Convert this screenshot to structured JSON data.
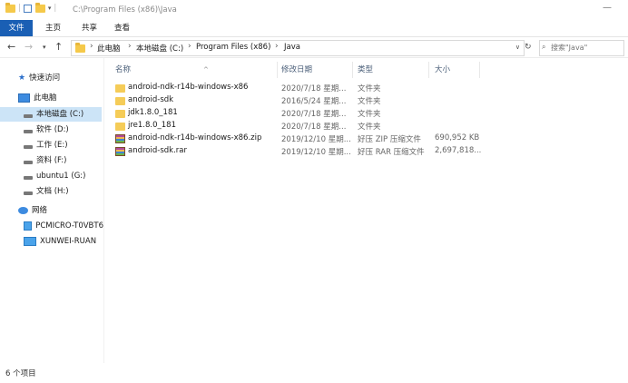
{
  "window": {
    "path": "C:\\Program Files (x86)\\Java"
  },
  "ribbon": {
    "tabs": [
      "文件",
      "主页",
      "共享",
      "查看"
    ]
  },
  "address": {
    "crumbs": [
      "此电脑",
      "本地磁盘 (C:)",
      "Program Files (x86)",
      "Java"
    ]
  },
  "search": {
    "placeholder": "搜索\"Java\""
  },
  "nav": {
    "quick_access": "快速访问",
    "this_pc": "此电脑",
    "drives": [
      "本地磁盘 (C:)",
      "软件 (D:)",
      "工作 (E:)",
      "资料 (F:)",
      "ubuntu1 (G:)",
      "文档 (H:)"
    ],
    "network": "网络",
    "computers": [
      "PCMICRO-T0VBT6",
      "XUNWEI-RUAN"
    ]
  },
  "columns": {
    "name": "名称",
    "date": "修改日期",
    "type": "类型",
    "size": "大小"
  },
  "files": [
    {
      "name": "android-ndk-r14b-windows-x86",
      "date": "2020/7/18 星期...",
      "type": "文件夹",
      "size": "",
      "icon": "folder-icon"
    },
    {
      "name": "android-sdk",
      "date": "2016/5/24 星期...",
      "type": "文件夹",
      "size": "",
      "icon": "folder-icon"
    },
    {
      "name": "jdk1.8.0_181",
      "date": "2020/7/18 星期...",
      "type": "文件夹",
      "size": "",
      "icon": "folder-icon"
    },
    {
      "name": "jre1.8.0_181",
      "date": "2020/7/18 星期...",
      "type": "文件夹",
      "size": "",
      "icon": "folder-icon"
    },
    {
      "name": "android-ndk-r14b-windows-x86.zip",
      "date": "2019/12/10 星期...",
      "type": "好压 ZIP 压缩文件",
      "size": "690,952 KB",
      "icon": "archive-icon"
    },
    {
      "name": "android-sdk.rar",
      "date": "2019/12/10 星期...",
      "type": "好压 RAR 压缩文件",
      "size": "2,697,818...",
      "icon": "archive-icon"
    }
  ],
  "status": {
    "item_count": "6 个项目"
  },
  "colors": {
    "accent": "#1a5fb4",
    "selection": "#cce4f7",
    "folder": "#f5cc58"
  }
}
